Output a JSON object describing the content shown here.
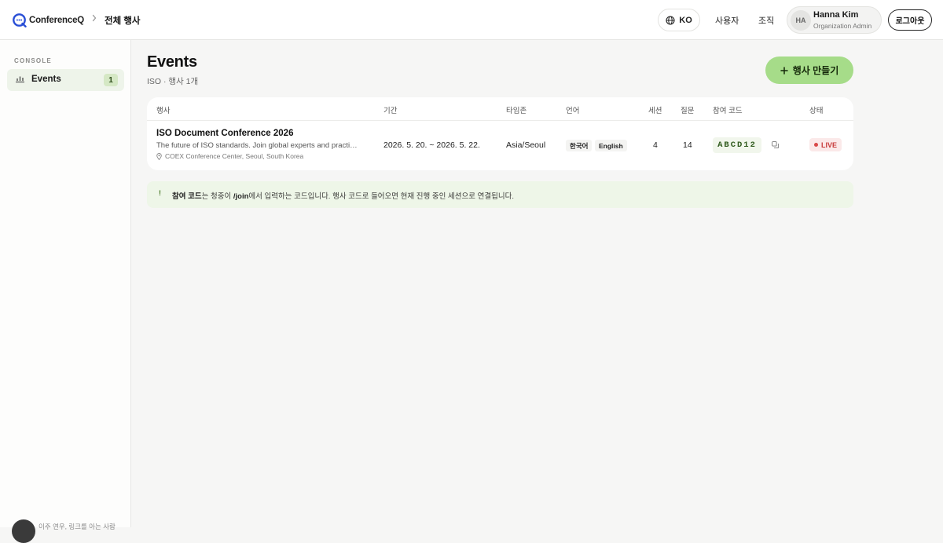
{
  "header": {
    "logo_text": "ConferenceQ",
    "breadcrumb_current": "전체 행사",
    "language": "KO",
    "nav": {
      "users": "사용자",
      "organization": "조직"
    },
    "user": {
      "initials": "HA",
      "name": "Hanna Kim",
      "role": "Organization Admin"
    },
    "logout_label": "로그아웃"
  },
  "sidebar": {
    "section_label": "CONSOLE",
    "items": [
      {
        "label": "Events",
        "count": "1",
        "icon": "chart-icon"
      }
    ],
    "footer_text": "이주 연우, 링크를 아는 사람"
  },
  "main": {
    "title": "Events",
    "subtitle": "ISO · 행사 1개",
    "create_button": "행사 만들기",
    "table": {
      "headers": {
        "event": "행사",
        "period": "기간",
        "timezone": "타임존",
        "language": "언어",
        "sessions": "세션",
        "questions": "질문",
        "join_code": "참여 코드",
        "status": "상태"
      },
      "rows": [
        {
          "name": "ISO Document Conference 2026",
          "description": "The future of ISO standards. Join global experts and practitioners",
          "location": "COEX Conference Center, Seoul, South Korea",
          "period": "2026. 5. 20. ~ 2026. 5. 22.",
          "timezone": "Asia/Seoul",
          "languages": [
            "한국어",
            "English"
          ],
          "sessions": "4",
          "questions": "14",
          "join_code": "ABCD12",
          "status": "LIVE"
        }
      ]
    },
    "info": {
      "icon": "!",
      "code_term": "참여 코드",
      "prefix": "는 청중이 ",
      "join_path": "/join",
      "suffix": "에서 입력하는 코드입니다. 행사 코드로 들어오면 현재 진행 중인 세션으로 연결됩니다."
    }
  },
  "colors": {
    "accent_green": "#a6dc89",
    "live_red": "#d94848",
    "code_green": "#2f5a1c"
  }
}
